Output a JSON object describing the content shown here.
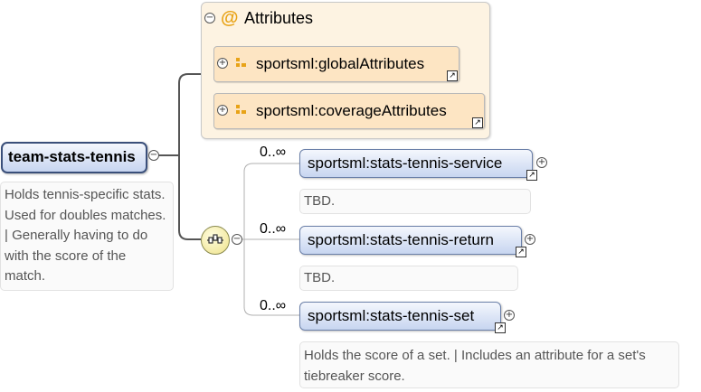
{
  "attributes": {
    "title": "Attributes",
    "at_symbol": "@",
    "items": [
      {
        "label": "sportsml:globalAttributes"
      },
      {
        "label": "sportsml:coverageAttributes"
      }
    ]
  },
  "root": {
    "label": "team-stats-tennis",
    "description": "Holds tennis-specific stats. Used for doubles matches. | Generally having to do with the score of the match."
  },
  "sequence": {
    "children": [
      {
        "label": "sportsml:stats-tennis-service",
        "cardinality": "0..∞",
        "description": "TBD."
      },
      {
        "label": "sportsml:stats-tennis-return",
        "cardinality": "0..∞",
        "description": "TBD."
      },
      {
        "label": "sportsml:stats-tennis-set",
        "cardinality": "0..∞",
        "description": "Holds the score of a set. | Includes an attribute for a set's tiebreaker score."
      }
    ]
  },
  "icons": {
    "collapse": "minus-circle-icon",
    "expand": "plus-circle-icon",
    "reference": "reference-arrow-icon",
    "attribute_group": "attribute-group-icon",
    "sequence": "sequence-compositor-icon"
  },
  "colors": {
    "attr_bg": "#fdf3e2",
    "attr_box": "#fde5c3",
    "element_gradient_top": "#f4f7fd",
    "element_gradient_bottom": "#c7d5f0",
    "at_symbol": "#e8a317"
  }
}
